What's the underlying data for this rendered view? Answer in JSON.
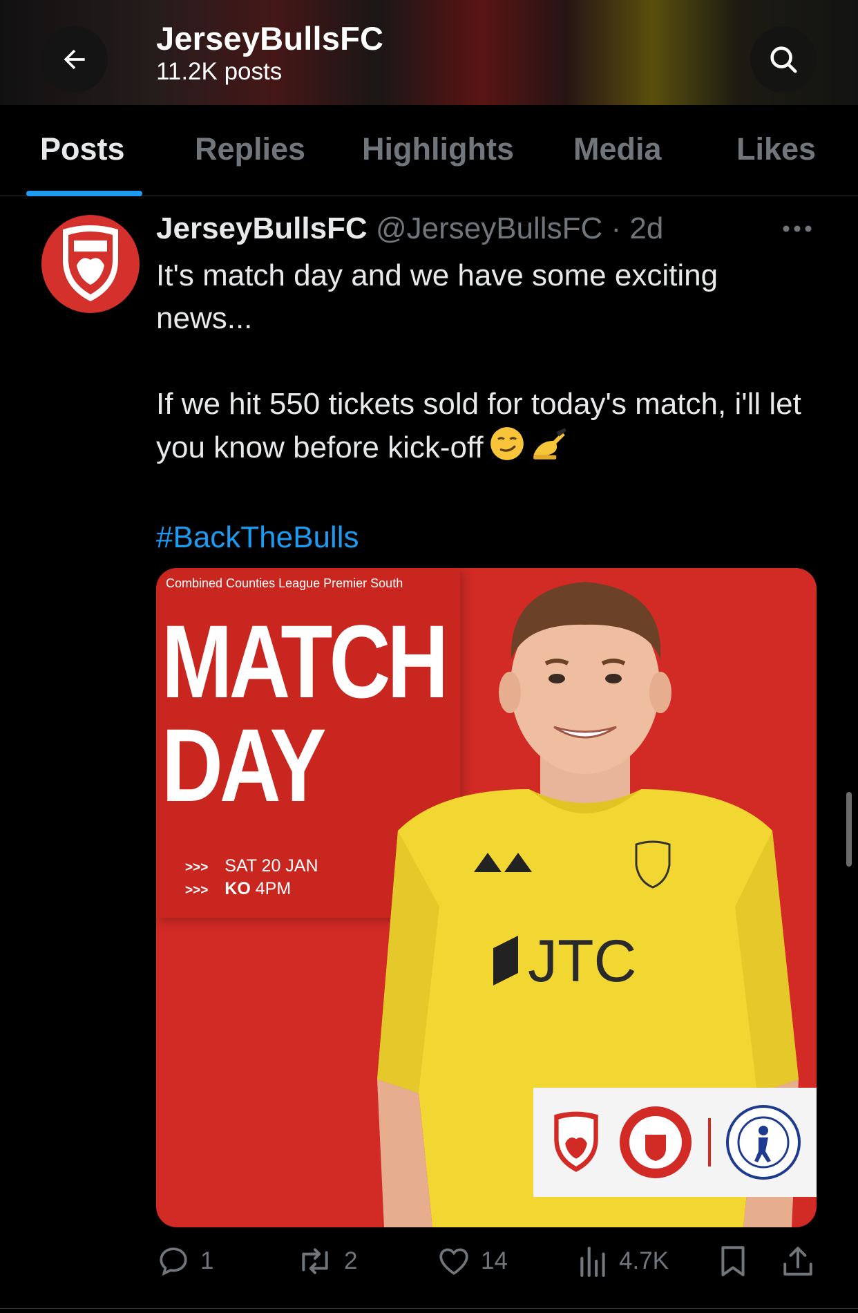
{
  "header": {
    "title": "JerseyBullsFC",
    "posts_count": "11.2K posts"
  },
  "tabs": [
    {
      "label": "Posts",
      "active": true
    },
    {
      "label": "Replies",
      "active": false
    },
    {
      "label": "Highlights",
      "active": false
    },
    {
      "label": "Media",
      "active": false
    },
    {
      "label": "Likes",
      "active": false
    }
  ],
  "post": {
    "author": "JerseyBullsFC",
    "handle": "@JerseyBullsFC",
    "separator": "·",
    "time": "2d",
    "text_line1": "It's match day and we have some exciting news...",
    "text_line2": "If we hit 550 tickets sold for today's match, i'll let you know before kick-off",
    "hashtag": "#BackTheBulls",
    "media": {
      "league": "Combined Counties League Premier South",
      "title_line1": "MATCH",
      "title_line2": "DAY",
      "date_prefix": ">>>",
      "date": "SAT 20 JAN",
      "ko_prefix": ">>>",
      "ko_label": "KO",
      "ko_time": "4PM",
      "sponsor": "JTC"
    },
    "actions": {
      "replies": "1",
      "reposts": "2",
      "likes": "14",
      "views": "4.7K"
    }
  },
  "colors": {
    "accent": "#1d9bf0",
    "club_red": "#d22a25",
    "kit_yellow": "#f2d733"
  }
}
